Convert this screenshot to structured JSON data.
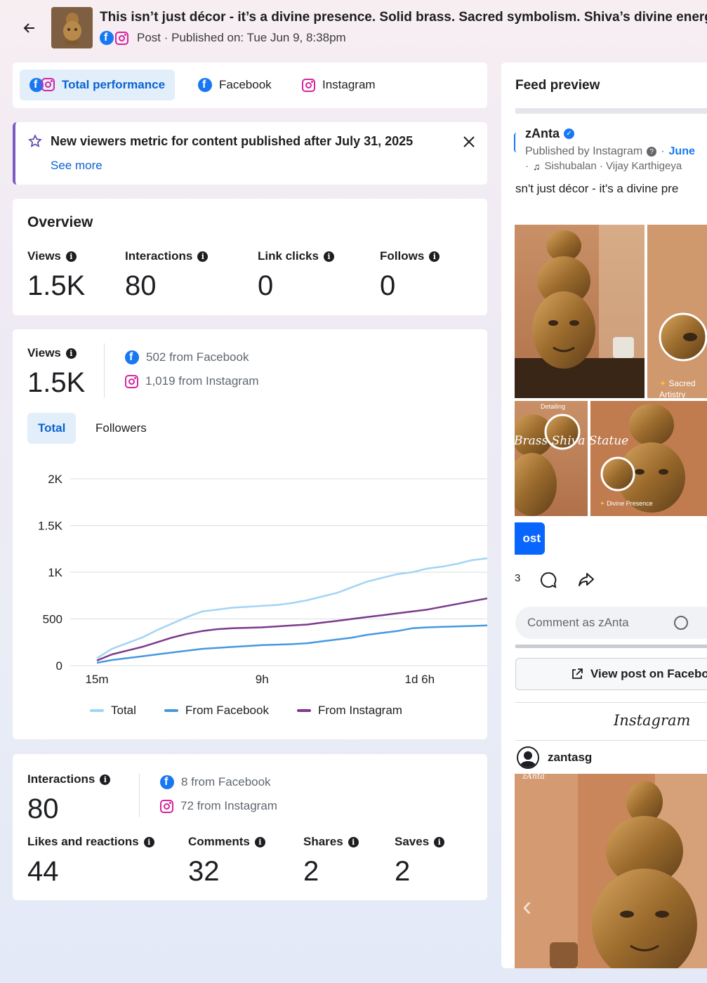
{
  "header": {
    "title": "This isn’t just décor - it’s a divine presence. Solid brass. Sacred symbolism. Shiva’s divine energy",
    "meta": "Post · Published on: Tue Jun 9, 8:38pm"
  },
  "tabs": [
    {
      "label": "Total performance",
      "active": true
    },
    {
      "label": "Facebook",
      "active": false
    },
    {
      "label": "Instagram",
      "active": false
    }
  ],
  "banner": {
    "text": "New viewers metric for content published after July 31, 2025",
    "link": "See more"
  },
  "overview": {
    "title": "Overview",
    "metrics": [
      {
        "label": "Views",
        "value": "1.5K"
      },
      {
        "label": "Interactions",
        "value": "80"
      },
      {
        "label": "Link clicks",
        "value": "0"
      },
      {
        "label": "Follows",
        "value": "0"
      }
    ]
  },
  "views": {
    "label": "Views",
    "value": "1.5K",
    "from_facebook": "502 from Facebook",
    "from_instagram": "1,019 from Instagram",
    "toggle": [
      "Total",
      "Followers"
    ]
  },
  "chart_data": {
    "type": "line",
    "x_ticks": [
      "15m",
      "9h",
      "1d 6h"
    ],
    "y_ticks": [
      "0",
      "500",
      "1K",
      "1.5K",
      "2K"
    ],
    "ylim": [
      0,
      2000
    ],
    "grid": true,
    "legend_position": "bottom",
    "x": [
      0,
      1,
      2,
      3,
      4,
      5,
      6,
      7,
      8,
      9,
      10,
      11,
      12,
      13,
      14,
      15,
      16,
      17,
      18,
      19,
      20,
      21,
      22,
      23,
      24,
      25,
      26
    ],
    "series": [
      {
        "name": "Total",
        "color": "#a3d4f5",
        "values": [
          80,
          180,
          240,
          300,
          380,
          450,
          520,
          580,
          600,
          620,
          630,
          640,
          650,
          670,
          700,
          740,
          780,
          840,
          900,
          940,
          980,
          1000,
          1040,
          1060,
          1090,
          1130,
          1150
        ]
      },
      {
        "name": "From Facebook",
        "color": "#4599df",
        "values": [
          30,
          60,
          80,
          100,
          120,
          140,
          160,
          180,
          190,
          200,
          210,
          220,
          225,
          230,
          240,
          260,
          280,
          300,
          330,
          350,
          370,
          400,
          410,
          415,
          420,
          425,
          430
        ]
      },
      {
        "name": "From Instagram",
        "color": "#7b3a8c",
        "values": [
          55,
          120,
          160,
          200,
          250,
          300,
          340,
          370,
          390,
          400,
          405,
          410,
          420,
          430,
          440,
          460,
          480,
          500,
          520,
          540,
          560,
          580,
          600,
          630,
          660,
          690,
          720
        ]
      }
    ]
  },
  "interactions": {
    "label": "Interactions",
    "value": "80",
    "from_facebook": "8 from Facebook",
    "from_instagram": "72 from Instagram",
    "metrics": [
      {
        "label": "Likes and reactions",
        "value": "44"
      },
      {
        "label": "Comments",
        "value": "32"
      },
      {
        "label": "Shares",
        "value": "2"
      },
      {
        "label": "Saves",
        "value": "2"
      }
    ]
  },
  "feed": {
    "title": "Feed preview",
    "page_name": "zAnta",
    "published_by": "Published by Instagram",
    "date": "June",
    "music": "Sishubalan · Vijay Karthigeya",
    "caption": "sn't just décor - it's a divine pre",
    "image_caption_1": "Brass Shiva Statue",
    "image_caption_2": "Sacred Artistry",
    "image_caption_3": "Detailing",
    "image_caption_4": "Divine Presence",
    "brand_mark": "zAnta",
    "boost_label": "ost",
    "reaction_count": "3",
    "comment_placeholder": "Comment as zAnta",
    "view_on_fb": "View post on Facebo",
    "instagram_logo": "Instagram",
    "ig_username": "zantasg"
  }
}
